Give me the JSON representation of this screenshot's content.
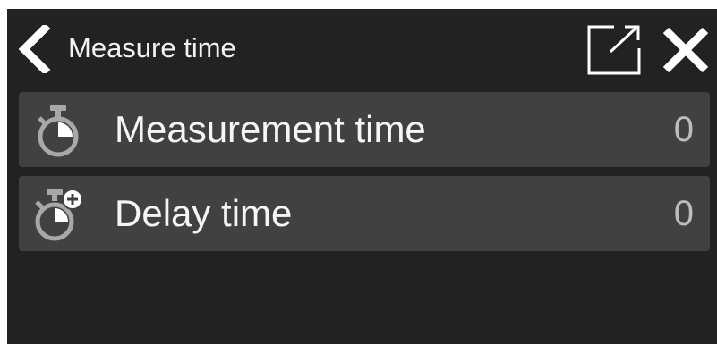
{
  "header": {
    "title": "Measure time",
    "back_icon": "chevron-left-icon",
    "popout_icon": "external-window-icon",
    "close_icon": "close-icon"
  },
  "settings": {
    "items": [
      {
        "label": "Measurement time",
        "value": "0",
        "icon": "stopwatch-icon"
      },
      {
        "label": "Delay time",
        "value": "0",
        "icon": "stopwatch-plus-icon"
      }
    ]
  },
  "colors": {
    "background": "#222222",
    "row_background": "#414141",
    "text": "#f5f5f5",
    "value_text": "#bdbdbd",
    "icon": "#a8a8a8"
  }
}
